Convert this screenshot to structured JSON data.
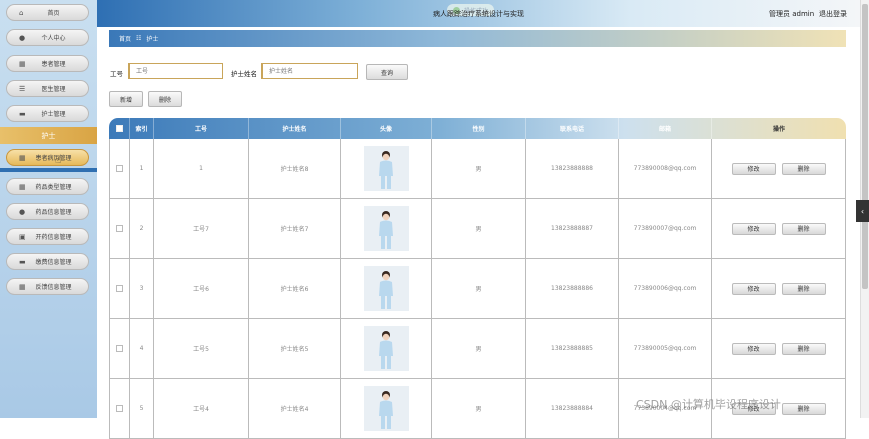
{
  "sidebar": {
    "items": [
      {
        "label": "首页",
        "icon": "home-icon",
        "glyph": "⌂"
      },
      {
        "label": "个人中心",
        "icon": "user-icon",
        "glyph": "●"
      },
      {
        "label": "患者管理",
        "icon": "grid-icon",
        "glyph": "▦"
      },
      {
        "label": "医生管理",
        "icon": "list-icon",
        "glyph": "☰"
      },
      {
        "label": "护士管理",
        "icon": "card-icon",
        "glyph": "▬"
      },
      {
        "label": "患者病历管理",
        "icon": "grid-icon",
        "glyph": "▦"
      },
      {
        "label": "药品类型管理",
        "icon": "grid-icon",
        "glyph": "▦"
      },
      {
        "label": "药品信息管理",
        "icon": "user-icon",
        "glyph": "●"
      },
      {
        "label": "开药信息管理",
        "icon": "pill-icon",
        "glyph": "▣"
      },
      {
        "label": "缴费信息管理",
        "icon": "card-icon",
        "glyph": "▬"
      },
      {
        "label": "反馈信息管理",
        "icon": "grid-icon",
        "glyph": "▦"
      }
    ],
    "group_label": "护士"
  },
  "topbar": {
    "toast": "操作成功",
    "title": "病人跟踪治疗系统设计与实现",
    "admin": "管理员 admin",
    "logout": "退出登录"
  },
  "breadcrumb": {
    "home": "首页",
    "sep": "☷",
    "current": "护士"
  },
  "search": {
    "id_label": "工号",
    "id_placeholder": "工号",
    "name_label": "护士姓名",
    "name_placeholder": "护士姓名",
    "query_button": "查询"
  },
  "actions": {
    "add": "新增",
    "delete": "删除"
  },
  "table": {
    "headers": [
      "索引",
      "工号",
      "护士姓名",
      "头像",
      "性别",
      "联系电话",
      "邮箱",
      "操作"
    ],
    "edit_label": "修改",
    "delete_label": "删除",
    "rows": [
      {
        "index": "1",
        "id": "1",
        "name": "护士姓名8",
        "gender": "男",
        "phone": "13823888888",
        "email": "773890008@qq.com"
      },
      {
        "index": "2",
        "id": "工号7",
        "name": "护士姓名7",
        "gender": "男",
        "phone": "13823888887",
        "email": "773890007@qq.com"
      },
      {
        "index": "3",
        "id": "工号6",
        "name": "护士姓名6",
        "gender": "男",
        "phone": "13823888886",
        "email": "773890006@qq.com"
      },
      {
        "index": "4",
        "id": "工号5",
        "name": "护士姓名5",
        "gender": "男",
        "phone": "13823888885",
        "email": "773890005@qq.com"
      },
      {
        "index": "5",
        "id": "工号4",
        "name": "护士姓名4",
        "gender": "男",
        "phone": "13823888884",
        "email": "773890004@qq.com"
      }
    ]
  },
  "watermark": "CSDN @计算机毕设程序设计",
  "colors": {
    "accent_blue": "#3c7ab9",
    "accent_gold": "#e6b95a"
  }
}
